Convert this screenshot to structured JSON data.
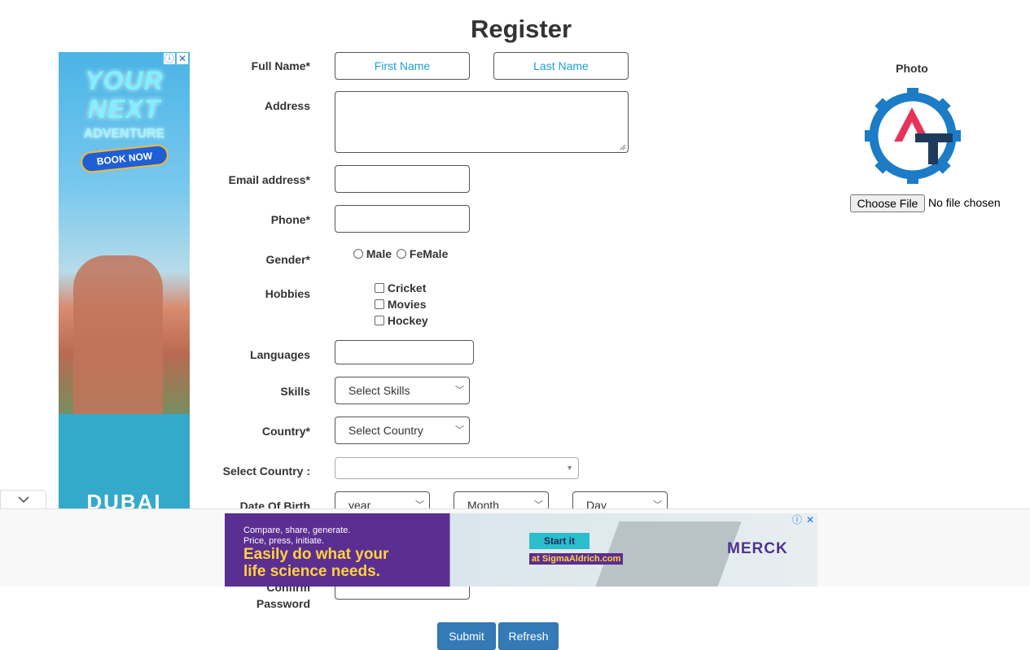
{
  "page": {
    "title": "Register"
  },
  "form": {
    "full_name": {
      "label": "Full Name*",
      "first_placeholder": "First Name",
      "last_placeholder": "Last Name"
    },
    "address": {
      "label": "Address"
    },
    "email": {
      "label": "Email address*"
    },
    "phone": {
      "label": "Phone*"
    },
    "gender": {
      "label": "Gender*",
      "options": [
        "Male",
        "FeMale"
      ]
    },
    "hobbies": {
      "label": "Hobbies",
      "options": [
        "Cricket",
        "Movies",
        "Hockey"
      ]
    },
    "languages": {
      "label": "Languages"
    },
    "skills": {
      "label": "Skills",
      "selected": "Select Skills"
    },
    "country": {
      "label": "Country*",
      "selected": "Select Country"
    },
    "select_country": {
      "label": "Select Country :",
      "selected": ""
    },
    "dob": {
      "label": "Date Of Birth",
      "year": "year",
      "month": "Month",
      "day": "Day"
    },
    "confirm_password": {
      "label_line1": "Confirm",
      "label_line2": "Password"
    },
    "buttons": {
      "submit": "Submit",
      "refresh": "Refresh"
    }
  },
  "photo": {
    "label": "Photo",
    "choose_file": "Choose File",
    "no_file": "No file chosen",
    "logo_colors": {
      "gear": "#1c7cc7",
      "a": "#e8325a",
      "t": "#1f3b5c"
    }
  },
  "ads": {
    "left": {
      "line1": "YOUR",
      "line2": "NEXT",
      "line3": "ADVENTURE",
      "cta": "BOOK NOW",
      "brand": "DUBAI"
    },
    "bottom": {
      "line1": "Compare, share, generate.",
      "line2": "Price, press, initiate.",
      "headline1": "Easily do what your",
      "headline2": "life science needs.",
      "cta": "Start it",
      "site": "at SigmaAldrich.com",
      "brand": "MERCK"
    },
    "collapse_icon": "chevron-down-icon",
    "info_icon": "info-icon",
    "close_icon": "close-icon"
  }
}
